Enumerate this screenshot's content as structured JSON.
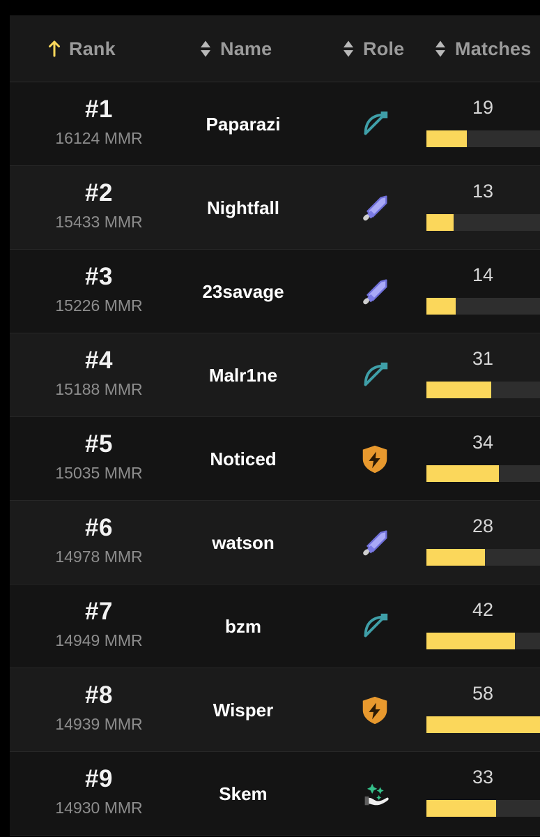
{
  "theme": {
    "page_bg": "#000000",
    "card_bg": "#141414",
    "row_alt_bg": "#1b1b1b",
    "header_bg": "#191919",
    "divider": "#272727",
    "accent_gold": "#fbd75b",
    "bar_track": "#2e2e2e",
    "text_primary": "#ffffff",
    "text_muted": "#8d8d8d",
    "header_text": "#9b9b9b"
  },
  "table": {
    "columns": [
      {
        "key": "rank",
        "label": "Rank",
        "sort_icon": "sort-ascending-icon",
        "sorted": true,
        "sort_direction": "asc"
      },
      {
        "key": "name",
        "label": "Name",
        "sort_icon": "sort-unsorted-icon",
        "sorted": false,
        "sort_direction": "none"
      },
      {
        "key": "role",
        "label": "Role",
        "sort_icon": "sort-unsorted-icon",
        "sorted": false,
        "sort_direction": "none"
      },
      {
        "key": "matches",
        "label": "Matches",
        "sort_icon": "sort-unsorted-icon",
        "sorted": false,
        "sort_direction": "none"
      }
    ],
    "mmr_suffix": "MMR",
    "rank_prefix": "#",
    "max_matches": 58,
    "rows": [
      {
        "rank": "#1",
        "mmr": "16124 MMR",
        "name": "Paparazi",
        "role_icon": "bow-and-arrow-icon",
        "role_color": "#3f9fa8",
        "matches": "19",
        "bar_pct": 33
      },
      {
        "rank": "#2",
        "mmr": "15433 MMR",
        "name": "Nightfall",
        "role_icon": "sword-icon",
        "role_color": "#8b8bf0",
        "matches": "13",
        "bar_pct": 22
      },
      {
        "rank": "#3",
        "mmr": "15226 MMR",
        "name": "23savage",
        "role_icon": "sword-icon",
        "role_color": "#8b8bf0",
        "matches": "14",
        "bar_pct": 24
      },
      {
        "rank": "#4",
        "mmr": "15188 MMR",
        "name": "Malr1ne",
        "role_icon": "bow-and-arrow-icon",
        "role_color": "#3f9fa8",
        "matches": "31",
        "bar_pct": 53
      },
      {
        "rank": "#5",
        "mmr": "15035 MMR",
        "name": "Noticed",
        "role_icon": "shield-bolt-icon",
        "role_color": "#e8992e",
        "matches": "34",
        "bar_pct": 59
      },
      {
        "rank": "#6",
        "mmr": "14978 MMR",
        "name": "watson",
        "role_icon": "sword-icon",
        "role_color": "#8b8bf0",
        "matches": "28",
        "bar_pct": 48
      },
      {
        "rank": "#7",
        "mmr": "14949 MMR",
        "name": "bzm",
        "role_icon": "bow-and-arrow-icon",
        "role_color": "#3f9fa8",
        "matches": "42",
        "bar_pct": 72
      },
      {
        "rank": "#8",
        "mmr": "14939 MMR",
        "name": "Wisper",
        "role_icon": "shield-bolt-icon",
        "role_color": "#e8992e",
        "matches": "58",
        "bar_pct": 100
      },
      {
        "rank": "#9",
        "mmr": "14930 MMR",
        "name": "Skem",
        "role_icon": "sparkle-hand-icon",
        "role_color": "#2fbd85",
        "matches": "33",
        "bar_pct": 57
      }
    ]
  },
  "chart_data": {
    "type": "bar",
    "title": "Matches",
    "categories": [
      "Paparazi",
      "Nightfall",
      "23savage",
      "Malr1ne",
      "Noticed",
      "watson",
      "bzm",
      "Wisper",
      "Skem"
    ],
    "values": [
      19,
      13,
      14,
      31,
      34,
      28,
      42,
      58,
      33
    ],
    "xlabel": "",
    "ylabel": "Matches",
    "ylim": [
      0,
      58
    ],
    "orientation": "horizontal",
    "grid": false,
    "legend": "none"
  }
}
